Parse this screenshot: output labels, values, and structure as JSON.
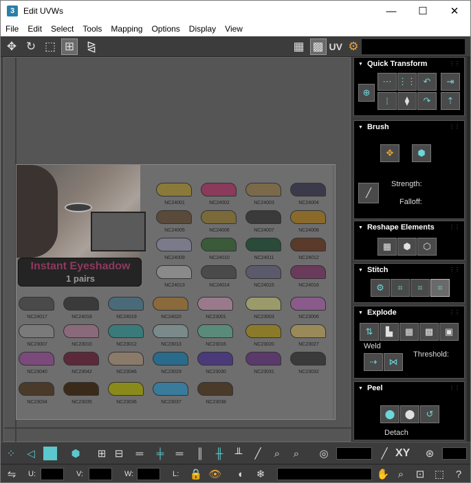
{
  "window": {
    "app_icon_text": "3",
    "title": "Edit UVWs",
    "minimize": "—",
    "maximize": "☐",
    "close": "✕"
  },
  "menu": [
    "File",
    "Edit",
    "Select",
    "Tools",
    "Mapping",
    "Options",
    "Display",
    "View"
  ],
  "toolbar": {
    "uv_label": "UV",
    "icons": [
      "move-icon",
      "rotate-icon",
      "scale-icon",
      "freeform-icon",
      "mirror-icon",
      "checker-icon",
      "texture-checker-icon",
      "uv-settings-icon"
    ]
  },
  "texture": {
    "banner_title": "Instant Eyeshadow",
    "banner_subtitle": "1 pairs",
    "swatches": [
      {
        "code": "NC24001",
        "color": "#8a7a3a"
      },
      {
        "code": "NC24002",
        "color": "#8a3a5a"
      },
      {
        "code": "NC24003",
        "color": "#7a6a4a"
      },
      {
        "code": "NC24004",
        "color": "#3a3a4a"
      },
      {
        "code": "NC24005",
        "color": "#5a4a3a"
      },
      {
        "code": "NC24006",
        "color": "#7a6a3a"
      },
      {
        "code": "NC24007",
        "color": "#3a3a3a"
      },
      {
        "code": "NC24008",
        "color": "#8a6a2a"
      },
      {
        "code": "NC24009",
        "color": "#7a7a8a"
      },
      {
        "code": "NC24010",
        "color": "#3a5a3a"
      },
      {
        "code": "NC24011",
        "color": "#2a4a3a"
      },
      {
        "code": "NC24012",
        "color": "#5a3a2a"
      },
      {
        "code": "NC24013",
        "color": "#8a8a8a"
      },
      {
        "code": "NC24014",
        "color": "#4a4a4a"
      },
      {
        "code": "NC24015",
        "color": "#5a5a6a"
      },
      {
        "code": "NC24016",
        "color": "#6a3a5a"
      },
      {
        "code": "NC24017",
        "color": "#4a4a4a"
      },
      {
        "code": "NC24018",
        "color": "#3a3a3a"
      },
      {
        "code": "NC24019",
        "color": "#4a6a7a"
      },
      {
        "code": "NC24020",
        "color": "#8a6a3a"
      },
      {
        "code": "NC23001",
        "color": "#9a7a8a"
      },
      {
        "code": "NC23003",
        "color": "#9a9a6a"
      },
      {
        "code": "NC23006",
        "color": "#8a5a8a"
      },
      {
        "code": "NC23007",
        "color": "#7a7a7a"
      },
      {
        "code": "NC23010",
        "color": "#8a6a7a"
      },
      {
        "code": "NC23012",
        "color": "#3a7a7a"
      },
      {
        "code": "NC23013",
        "color": "#7a8a8a"
      },
      {
        "code": "NC23016",
        "color": "#5a8a7a"
      },
      {
        "code": "NC23020",
        "color": "#8a7a2a"
      },
      {
        "code": "NC23027",
        "color": "#9a8a5a"
      },
      {
        "code": "NC23040",
        "color": "#7a4a7a"
      },
      {
        "code": "NC23042",
        "color": "#5a2a3a"
      },
      {
        "code": "NC23046",
        "color": "#8a7a6a"
      },
      {
        "code": "NC23029",
        "color": "#2a6a8a"
      },
      {
        "code": "NC23030",
        "color": "#4a3a7a"
      },
      {
        "code": "NC23031",
        "color": "#5a3a6a"
      },
      {
        "code": "NC23032",
        "color": "#3a3a3a"
      },
      {
        "code": "NC23034",
        "color": "#4a3a2a"
      },
      {
        "code": "NC23035",
        "color": "#3a2a1a"
      },
      {
        "code": "NC23036",
        "color": "#8a8a1a"
      },
      {
        "code": "NC23037",
        "color": "#3a7a9a"
      },
      {
        "code": "NC23038",
        "color": "#4a3a2a"
      }
    ]
  },
  "panels": {
    "quick_transform": {
      "title": "Quick Transform"
    },
    "brush": {
      "title": "Brush",
      "strength_label": "Strength:",
      "falloff_label": "Falloff:"
    },
    "reshape": {
      "title": "Reshape Elements"
    },
    "stitch": {
      "title": "Stitch"
    },
    "explode": {
      "title": "Explode",
      "weld_label": "Weld",
      "threshold_label": "Threshold:"
    },
    "peel": {
      "title": "Peel",
      "detach_label": "Detach"
    }
  },
  "bottom": {
    "xy_label": "XY",
    "u_label": "U:",
    "v_label": "V:",
    "w_label": "W:",
    "l_label": "L:"
  },
  "colors": {
    "accent_cyan": "#5ac8cc",
    "panel_bg": "#000000",
    "toolbar_bg": "#3c3c3c"
  }
}
